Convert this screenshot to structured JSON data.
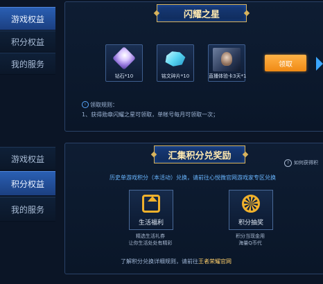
{
  "sidebar_top": [
    {
      "label": "游戏权益",
      "active": true
    },
    {
      "label": "积分权益",
      "active": false
    },
    {
      "label": "我的服务",
      "active": false
    }
  ],
  "sidebar_bottom": [
    {
      "label": "游戏权益",
      "active": false
    },
    {
      "label": "积分权益",
      "active": true
    },
    {
      "label": "我的服务",
      "active": false
    }
  ],
  "shine_star": {
    "title": "闪耀之星",
    "rewards": [
      {
        "label": "钻石*10",
        "icon": "diamond-icon"
      },
      {
        "label": "铭文碎片*10",
        "icon": "crystal-icon"
      },
      {
        "label": "直播体验卡3天*1",
        "icon": "hero-card-icon"
      }
    ],
    "claim_label": "领取",
    "rules_title": "领取规则：",
    "rules": [
      "1、获得勋章闪耀之星可领取，单帐号每月可领取一次；"
    ]
  },
  "points_exchange": {
    "title": "汇集积分兑奖励",
    "help_label": "如何获得积",
    "info": "历史单游戏积分（本活动）兑换，请前往心悦微官网游戏家专区兑换",
    "cards": [
      {
        "caption": "生活福利",
        "icon": "house-icon",
        "desc": [
          "精选生活礼券",
          "让你生活处处有精彩"
        ]
      },
      {
        "caption": "积分抽奖",
        "icon": "wheel-icon",
        "desc": [
          "积分当现金用",
          "海量Q币代"
        ]
      }
    ],
    "footer_prefix": "了解积分兑换详细规则，请前往",
    "footer_link": "王者荣耀官网"
  },
  "colors": {
    "accent_gold": "#d8b35c",
    "active_tab": "#2a5fb3",
    "claim_button": "#f08a15",
    "link_blue": "#69b6ff"
  }
}
